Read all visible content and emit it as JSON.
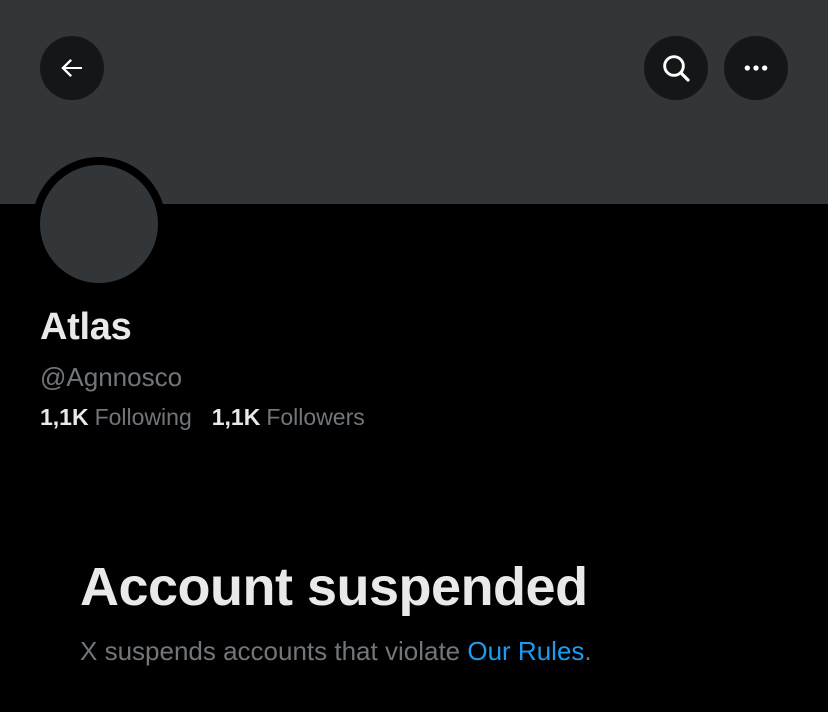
{
  "profile": {
    "display_name": "Atlas",
    "handle": "@Agnnosco",
    "following_count": "1,1K",
    "following_label": "Following",
    "followers_count": "1,1K",
    "followers_label": "Followers"
  },
  "notice": {
    "title": "Account suspended",
    "body_prefix": "X suspends accounts that violate ",
    "link_label": "Our Rules",
    "body_suffix": "."
  },
  "icons": {
    "back": "arrow-left-icon",
    "search": "search-icon",
    "more": "more-horizontal-icon"
  },
  "colors": {
    "background": "#000000",
    "banner": "#333639",
    "button_bg": "#151618",
    "text_primary": "#e7e9ea",
    "text_secondary": "#71767b",
    "link": "#1d9bf0"
  }
}
